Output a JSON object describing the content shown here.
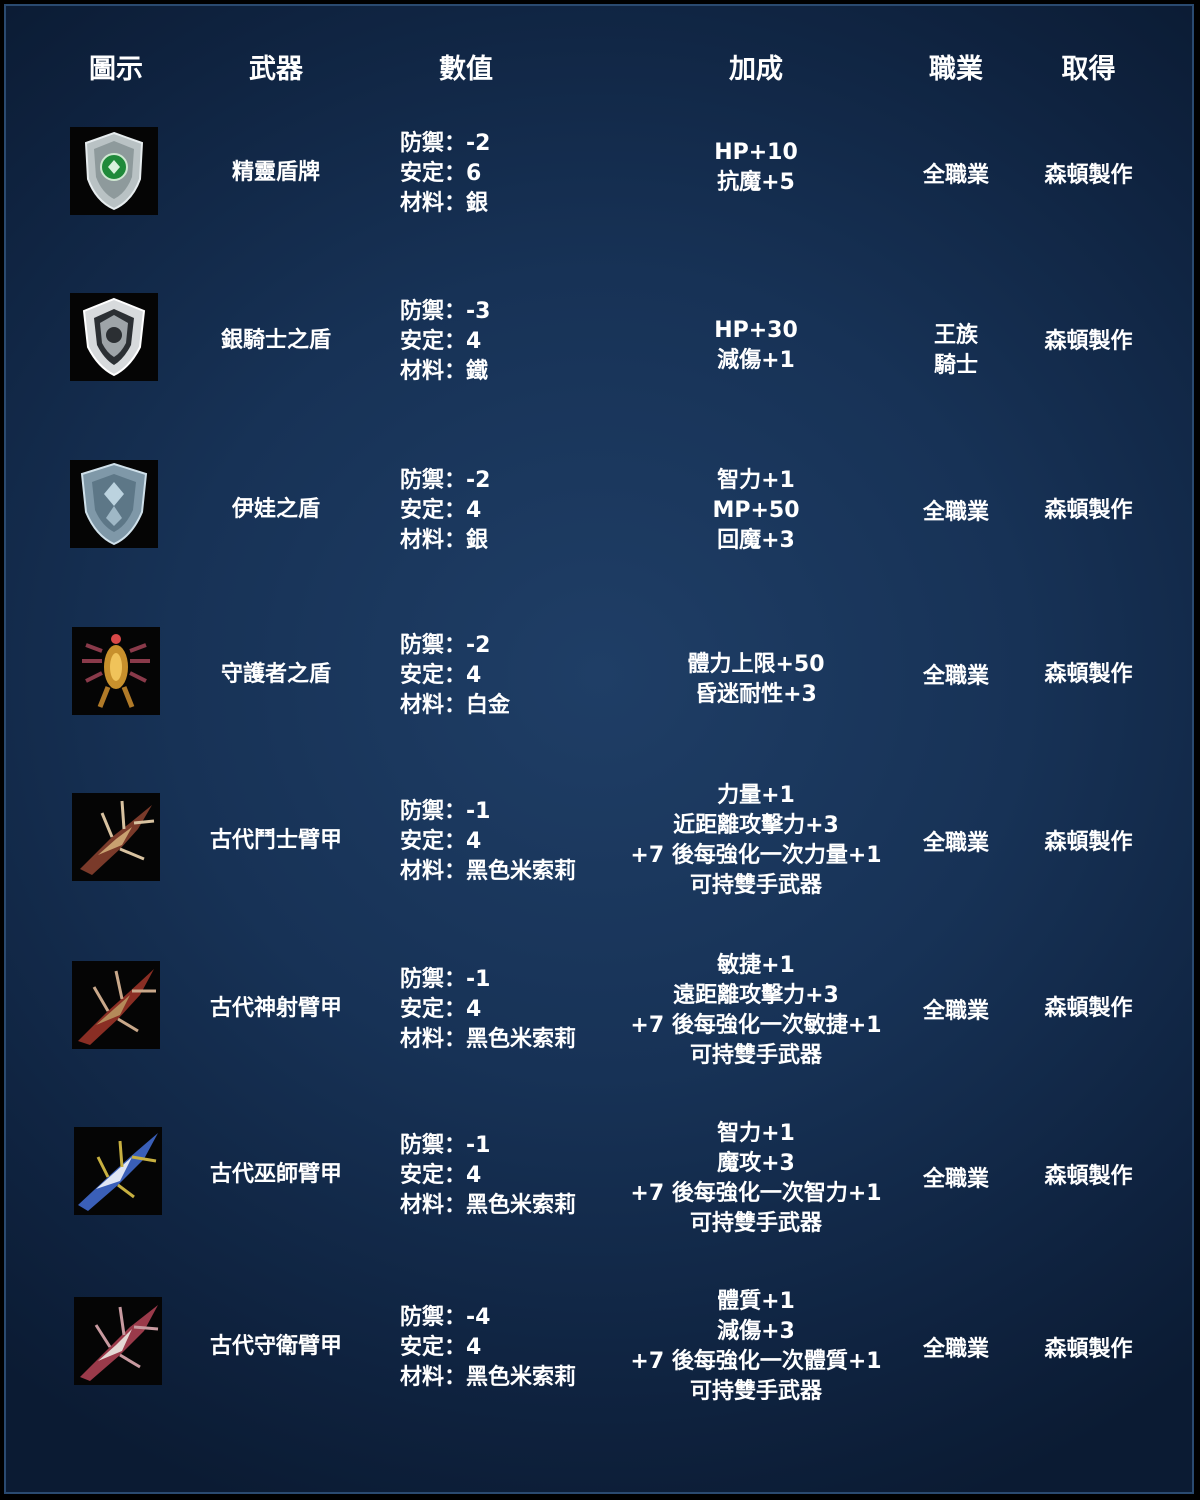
{
  "headers": {
    "icon": "圖示",
    "weapon": "武器",
    "value": "數值",
    "bonus": "加成",
    "class": "職業",
    "obtain": "取得"
  },
  "rows": [
    {
      "icon": "elven-shield-icon",
      "name": "精靈盾牌",
      "stats": [
        "防禦：-2",
        "安定：6",
        "材料：銀"
      ],
      "bonus": [
        "HP+10",
        "抗魔+5"
      ],
      "class": [
        "全職業"
      ],
      "obtain": "森頓製作"
    },
    {
      "icon": "silver-knight-shield-icon",
      "name": "銀騎士之盾",
      "stats": [
        "防禦：-3",
        "安定：4",
        "材料：鐵"
      ],
      "bonus": [
        "HP+30",
        "減傷+1"
      ],
      "class": [
        "王族",
        "騎士"
      ],
      "obtain": "森頓製作"
    },
    {
      "icon": "eva-shield-icon",
      "name": "伊娃之盾",
      "stats": [
        "防禦：-2",
        "安定：4",
        "材料：銀"
      ],
      "bonus": [
        "智力+1",
        "MP+50",
        "回魔+3"
      ],
      "class": [
        "全職業"
      ],
      "obtain": "森頓製作"
    },
    {
      "icon": "guardian-shield-icon",
      "name": "守護者之盾",
      "stats": [
        "防禦：-2",
        "安定：4",
        "材料：白金"
      ],
      "bonus": [
        "體力上限+50",
        "昏迷耐性+3"
      ],
      "class": [
        "全職業"
      ],
      "obtain": "森頓製作"
    },
    {
      "icon": "ancient-warrior-armguard-icon",
      "name": "古代鬥士臂甲",
      "stats": [
        "防禦：-1",
        "安定：4",
        "材料：黑色米索莉"
      ],
      "bonus": [
        "力量+1",
        "近距離攻擊力+3",
        "+7 後每強化一次力量+1",
        "可持雙手武器"
      ],
      "class": [
        "全職業"
      ],
      "obtain": "森頓製作"
    },
    {
      "icon": "ancient-archer-armguard-icon",
      "name": "古代神射臂甲",
      "stats": [
        "防禦：-1",
        "安定：4",
        "材料：黑色米索莉"
      ],
      "bonus": [
        "敏捷+1",
        "遠距離攻擊力+3",
        "+7 後每強化一次敏捷+1",
        "可持雙手武器"
      ],
      "class": [
        "全職業"
      ],
      "obtain": "森頓製作"
    },
    {
      "icon": "ancient-mage-armguard-icon",
      "name": "古代巫師臂甲",
      "stats": [
        "防禦：-1",
        "安定：4",
        "材料：黑色米索莉"
      ],
      "bonus": [
        "智力+1",
        "魔攻+3",
        "+7 後每強化一次智力+1",
        "可持雙手武器"
      ],
      "class": [
        "全職業"
      ],
      "obtain": "森頓製作"
    },
    {
      "icon": "ancient-guardian-armguard-icon",
      "name": "古代守衛臂甲",
      "stats": [
        "防禦：-4",
        "安定：4",
        "材料：黑色米索莉"
      ],
      "bonus": [
        "體質+1",
        "減傷+3",
        "+7 後每強化一次體質+1",
        "可持雙手武器"
      ],
      "class": [
        "全職業"
      ],
      "obtain": "森頓製作"
    }
  ]
}
